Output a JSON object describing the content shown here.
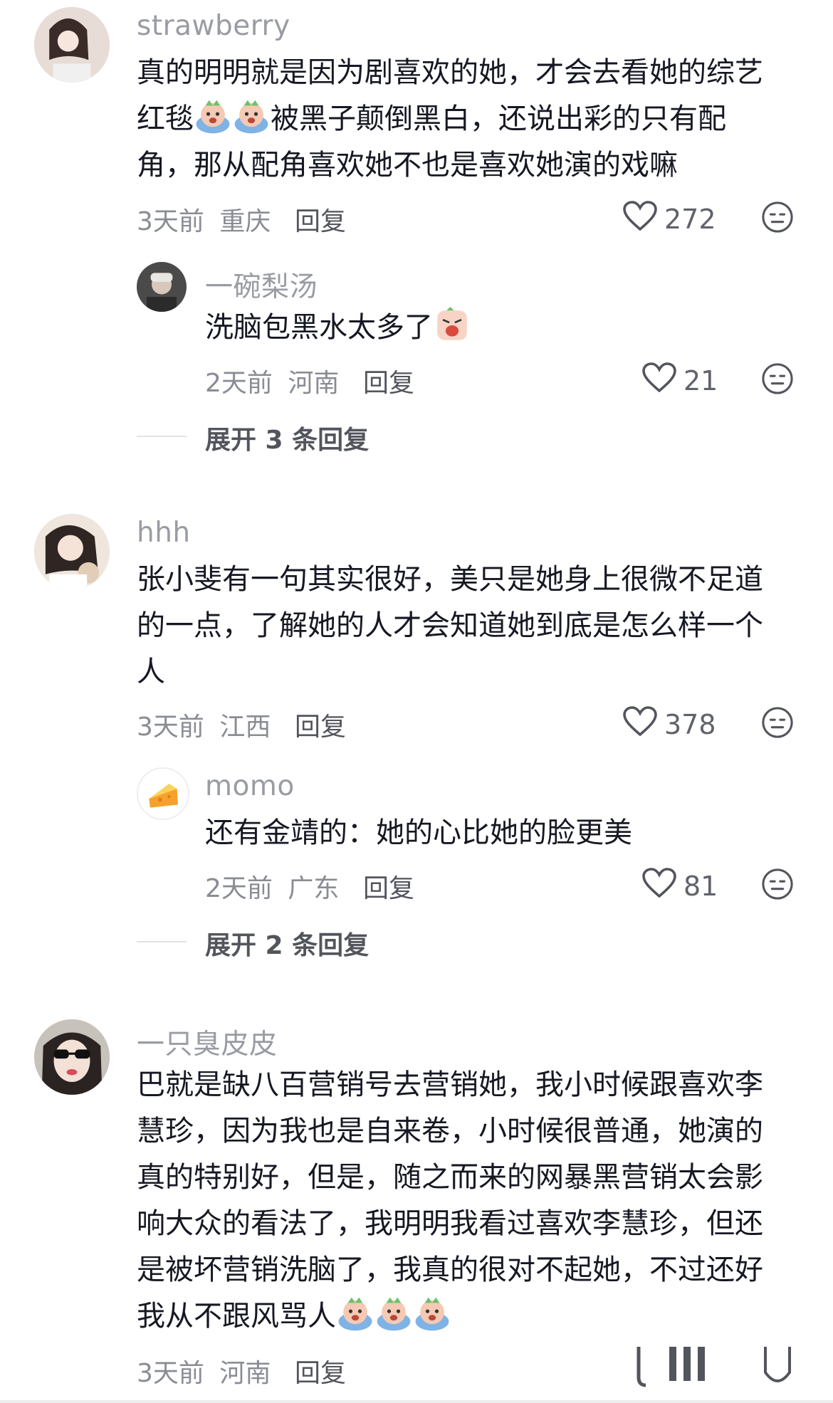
{
  "comments": [
    {
      "user": "strawberry",
      "lines": [
        "真的明明就是因为剧喜欢的她，才会去看她的综艺",
        "被黑子颠倒黑白，还说出彩的只有配",
        "角，那从配角喜欢她不也是喜欢她演的戏嘛"
      ],
      "line2_prefix": "红毯",
      "time": "3天前",
      "location": "重庆",
      "reply": "回复",
      "likes": "272",
      "sub_replies": [
        {
          "user": "一碗梨汤",
          "text": "洗脑包黑水太多了",
          "time": "2天前",
          "location": "河南",
          "reply": "回复",
          "likes": "21"
        }
      ],
      "expand": "展开 3 条回复"
    },
    {
      "user": "hhh",
      "lines": [
        "张小斐有一句其实很好，美只是她身上很微不足道",
        "的一点，了解她的人才会知道她到底是怎么样一个",
        "人"
      ],
      "time": "3天前",
      "location": "江西",
      "reply": "回复",
      "likes": "378",
      "sub_replies": [
        {
          "user": "momo",
          "text": "还有金靖的：她的心比她的脸更美",
          "time": "2天前",
          "location": "广东",
          "reply": "回复",
          "likes": "81"
        }
      ],
      "expand": "展开 2 条回复"
    },
    {
      "user": "一只臭皮皮",
      "lines": [
        "巴就是缺八百营销号去营销她，我小时候跟喜欢李",
        "慧珍，因为我也是自来卷，小时候很普通，她演的",
        "真的特别好，但是，随之而来的网暴黑营销太会影",
        "响大众的看法了，我明明我看过喜欢李慧珍，但还",
        "是被坏营销洗脑了，我真的很对不起她，不过还好",
        "我从不跟风骂人"
      ],
      "time": "3天前",
      "location": "河南",
      "reply": "回复"
    }
  ],
  "icons": {
    "like": "heart-outline-icon",
    "dislike": "neutral-face-icon",
    "emoji_cry": "crying-emoji-icon",
    "emoji_angry": "angry-emoji-icon"
  },
  "colors": {
    "username": "#9a9ca4",
    "text": "#161823",
    "meta": "#8a8c94"
  }
}
